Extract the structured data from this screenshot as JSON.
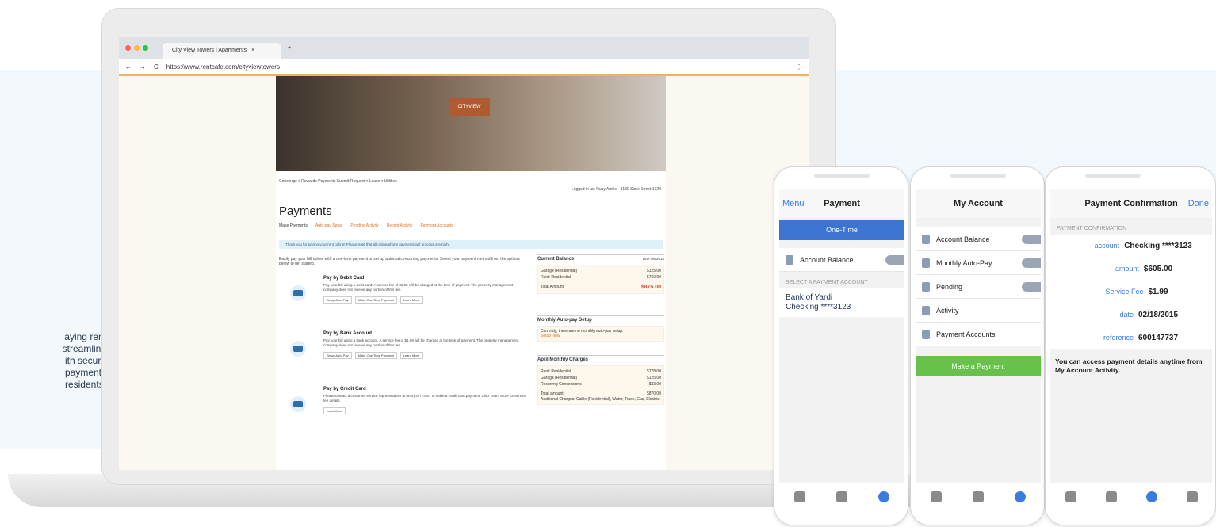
{
  "side_text": [
    "aying rent",
    "streamline",
    "ith secure",
    "payments",
    "residents."
  ],
  "browser": {
    "tab_title": "City View Towers | Apartments",
    "tab_close": "×",
    "new_tab": "+",
    "url": "https://www.rentcafe.com/cityviewtowers",
    "menu_icon": "⋮"
  },
  "site": {
    "logo": "CITYVIEW",
    "nav": "Concierge ▾   Rewards   Payments   Submit Request ▾   Lease ▾   Utilities",
    "logged_in": "Logged in as: Ruby Amhe · 3130 State Street 1320",
    "title": "Payments",
    "tabs": [
      "Make Payments",
      "Auto-pay Setup",
      "Pending Activity",
      "Recent Activity",
      "Payment Accounts"
    ],
    "notice": "Thank you for paying your rent online! Please note that all online/phone payments will process overnight.",
    "intro": "Easily pay your bill online with a one-time payment or set up automatic recurring payments. Select your payment method from the options below to get started.",
    "options": [
      {
        "title": "Pay by Debit Card",
        "desc": "Pay your bill using a debit card. A service fee of $2.95 will be charged at the time of payment. The property management company does not receive any portion of this fee.",
        "b1": "Setup Auto Pay",
        "b2": "Make One Time Payment",
        "b3": "Learn More"
      },
      {
        "title": "Pay by Bank Account",
        "desc": "Pay your bill using a bank account. A service fee of $1.99 will be charged at the time of payment. The property management company does not receive any portion of this fee.",
        "b1": "Setup Auto Pay",
        "b2": "Make One Time Payment",
        "b3": "Learn More"
      },
      {
        "title": "Pay by Credit Card",
        "desc": "Please contact a customer service representative at (844) 447-0387 to make a credit card payment. Click Learn More for service fee details.",
        "b3": "Learn More"
      }
    ],
    "balance": {
      "title": "Current Balance",
      "due": "Due 4/8/2015",
      "r1l": "Garage (Residential)",
      "r1v": "$125.00",
      "r2l": "Rent: Residential",
      "r2v": "$750.00",
      "tl": "Total Amount",
      "tv": "$875.00"
    },
    "autopay": {
      "title": "Monthly Auto-pay Setup",
      "text": "Currently, there are no monthly auto-pay setup.",
      "link": "Setup Now"
    },
    "charges": {
      "title": "April Monthly Charges",
      "r1l": "Rent: Residential",
      "r1v": "$778.00",
      "r2l": "Garage (Residential)",
      "r2v": "$125.00",
      "r3l": "Recurring Concessions",
      "r3v": "-$33.00",
      "tl": "Total amount",
      "tv": "$870.00",
      "extra": "Additional Charges: Cable (Residential), Water, Trash, Gas, Electric"
    }
  },
  "phone1": {
    "back": "Menu",
    "title": "Payment",
    "tab": "One-Time",
    "item": "Account Balance",
    "section": "SELECT A PAYMENT ACCOUNT",
    "bank_name": "Bank of Yardi",
    "bank_acct": "Checking ****3123"
  },
  "phone2": {
    "title": "My Account",
    "items": [
      "Account Balance",
      "Monthly Auto-Pay",
      "Pending",
      "Activity",
      "Payment Accounts"
    ],
    "button": "Make a Payment"
  },
  "phone3": {
    "title": "Payment Confirmation",
    "done": "Done",
    "section": "PAYMENT CONFIRMATION",
    "rows": [
      [
        "account",
        "Checking ****3123"
      ],
      [
        "amount",
        "$605.00"
      ],
      [
        "Service Fee",
        "$1.99"
      ],
      [
        "date",
        "02/18/2015"
      ],
      [
        "reference",
        "600147737"
      ]
    ],
    "note": "You can access payment details anytime from My Account Activity."
  },
  "colors": {
    "accent": "#3c74d2",
    "green": "#67c24b",
    "orange": "#d9742c",
    "red": "#e0463a"
  }
}
